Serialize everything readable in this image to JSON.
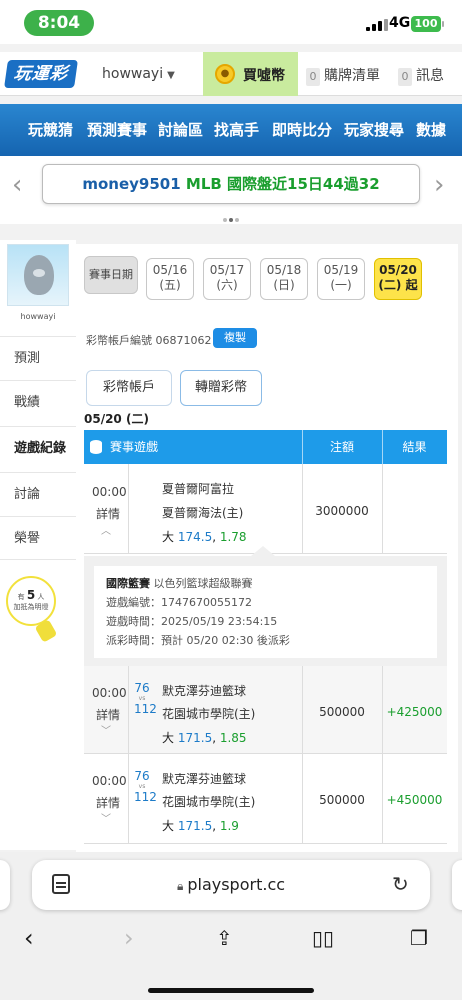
{
  "status": {
    "time": "8:04",
    "network": "4G",
    "battery": "100"
  },
  "header": {
    "logo": "玩運彩",
    "username": "howwayi",
    "buy_label": "買噓幣",
    "cart_count": "0",
    "cart_label": "購牌清單",
    "msg_count": "0",
    "msg_label": "訊息"
  },
  "nav": [
    "玩競猜",
    "預測賽事",
    "討論區",
    "找高手",
    "即時比分",
    "玩家搜尋",
    "數據"
  ],
  "announcement": {
    "user": "money9501",
    "text": "MLB 國際盤近15日44過32"
  },
  "sidebar": {
    "username": "howwayi",
    "items": [
      "預測",
      "戰績",
      "遊戲紀錄",
      "討論",
      "榮譽"
    ],
    "bulb_prefix": "有",
    "bulb_count": "5",
    "bulb_unit": "人",
    "bulb_text": "加抵為明燈"
  },
  "main": {
    "date_label": "賽事日期",
    "dates": [
      {
        "date": "05/16",
        "day": "(五)"
      },
      {
        "date": "05/17",
        "day": "(六)"
      },
      {
        "date": "05/18",
        "day": "(日)"
      },
      {
        "date": "05/19",
        "day": "(一)"
      },
      {
        "date": "05/20",
        "day": "(二) 起"
      }
    ],
    "account_label": "彩幣帳戶編號",
    "account_no": "06871062",
    "copy_label": "複製",
    "tab_account": "彩幣帳戶",
    "tab_transfer": "轉贈彩幣",
    "current_date": "05/20 (二)",
    "table_headers": {
      "game": "賽事遊戲",
      "amount": "注額",
      "result": "結果"
    },
    "details_label": "詳情",
    "rows": [
      {
        "time": "00:00",
        "away": "夏普爾阿富拉",
        "home": "夏普爾海法(主)",
        "bet_side": "大",
        "line": "174.5",
        "odds": "1.78",
        "amount": "3000000",
        "result": ""
      },
      {
        "time": "00:00",
        "away_score": "76",
        "home_score": "112",
        "vs": "vs",
        "away": "默克澤芬迪籃球",
        "home": "花園城市學院(主)",
        "bet_side": "大",
        "line": "171.5",
        "odds": "1.85",
        "amount": "500000",
        "result": "+425000"
      },
      {
        "time": "00:00",
        "away_score": "76",
        "home_score": "112",
        "vs": "vs",
        "away": "默克澤芬迪籃球",
        "home": "花園城市學院(主)",
        "bet_side": "大",
        "line": "171.5",
        "odds": "1.9",
        "amount": "500000",
        "result": "+450000"
      }
    ],
    "detail": {
      "league_label": "國際籃賽",
      "league_name": "以色列籃球超級聯賽",
      "game_id": "遊戲編號：1747670055172",
      "game_time": "遊戲時間：2025/05/19 23:54:15",
      "payout_time": "派彩時間：預計 05/20 02:30 後派彩"
    }
  },
  "browser": {
    "url": "playsport.cc"
  }
}
